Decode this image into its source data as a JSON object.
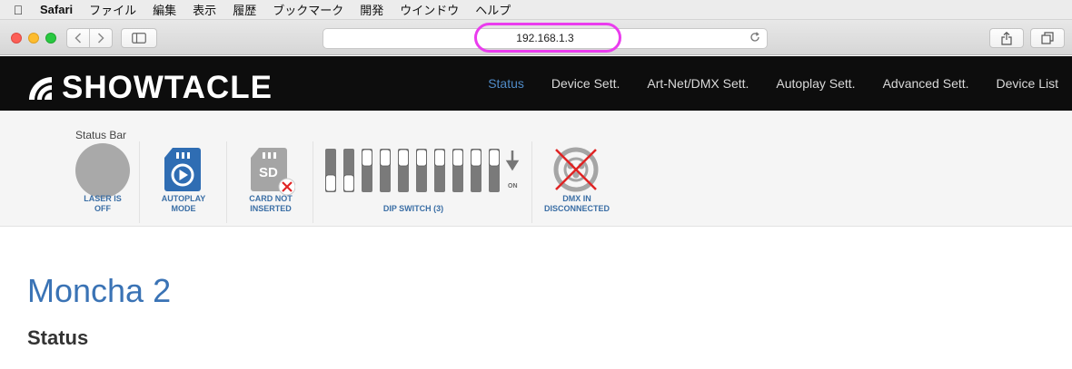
{
  "menubar": {
    "apple_icon": "apple-logo-icon",
    "items": [
      "Safari",
      "ファイル",
      "編集",
      "表示",
      "履歴",
      "ブックマーク",
      "開発",
      "ウインドウ",
      "ヘルプ"
    ]
  },
  "browser": {
    "url": "192.168.1.3"
  },
  "site": {
    "logo_text": "SHOWTACLE",
    "nav": [
      "Status",
      "Device Sett.",
      "Art-Net/DMX Sett.",
      "Autoplay Sett.",
      "Advanced Sett.",
      "Device List"
    ],
    "active_nav": "Status"
  },
  "status_bar": {
    "title": "Status Bar",
    "laser_label": "LASER IS OFF",
    "autoplay_label": "AUTOPLAY MODE",
    "card_label": "CARD NOT INSERTED",
    "card_icon_text": "SD",
    "dip_label": "DIP SWITCH (3)",
    "dip_on_label": "ON",
    "dip_switches": [
      false,
      false,
      true,
      true,
      true,
      true,
      true,
      true,
      true,
      true
    ],
    "dmx_label": "DMX IN DISCONNECTED"
  },
  "main": {
    "device_name": "Moncha 2",
    "section_title": "Status"
  },
  "colors": {
    "accent": "#3a73b5",
    "nav_active": "#4f8ac6",
    "highlight_ring": "#ea3cee"
  }
}
